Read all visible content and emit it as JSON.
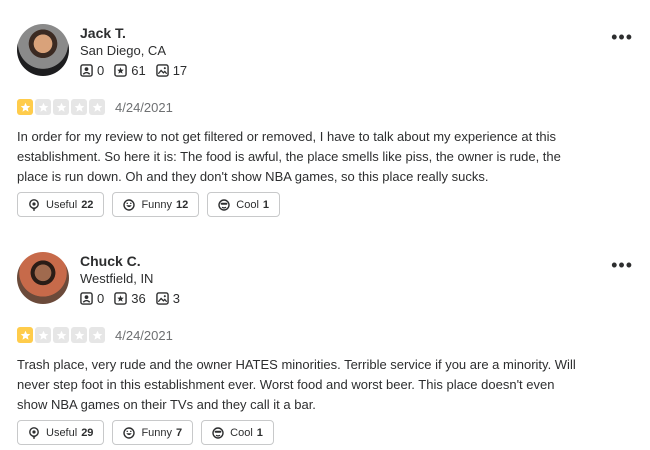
{
  "reviews": [
    {
      "name": "Jack T.",
      "location": "San Diego, CA",
      "stats": {
        "friends": "0",
        "reviews": "61",
        "photos": "17"
      },
      "rating": 1,
      "date": "4/24/2021",
      "text": "In order for my review to not get filtered or removed, I have to talk about my experience at this establishment. So here it is: The food is awful, the place smells like piss, the owner is rude, the place is run down. Oh and they don't show NBA games, so this place really sucks.",
      "reactions": {
        "useful_label": "Useful",
        "useful_count": "22",
        "funny_label": "Funny",
        "funny_count": "12",
        "cool_label": "Cool",
        "cool_count": "1"
      }
    },
    {
      "name": "Chuck C.",
      "location": "Westfield, IN",
      "stats": {
        "friends": "0",
        "reviews": "36",
        "photos": "3"
      },
      "rating": 1,
      "date": "4/24/2021",
      "text": "Trash place, very rude and the owner HATES minorities.  Terrible service if you are a minority. Will never step foot in this establishment ever. Worst food and worst beer. This place doesn't even show NBA games on their TVs and they call it a bar.",
      "reactions": {
        "useful_label": "Useful",
        "useful_count": "29",
        "funny_label": "Funny",
        "funny_count": "7",
        "cool_label": "Cool",
        "cool_count": "1"
      }
    }
  ],
  "more_menu_glyph": "•••",
  "colors": {
    "star_on": "#ffcc4b",
    "star_off": "#e6e6e6",
    "text": "#2d2e2f",
    "muted": "#6e7072"
  }
}
